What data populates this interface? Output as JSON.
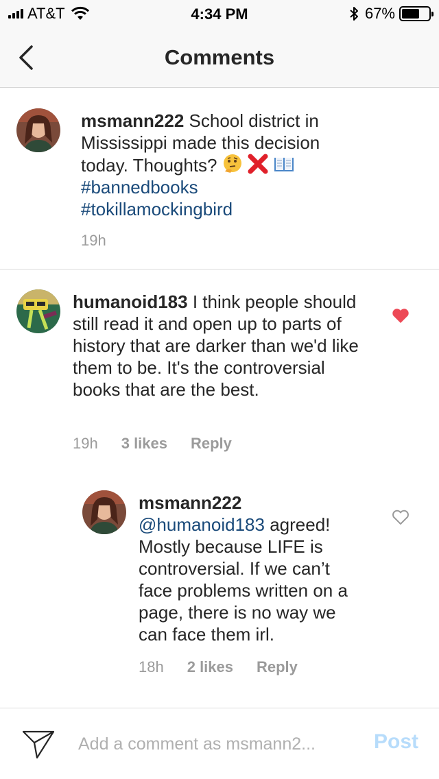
{
  "status_bar": {
    "carrier": "AT&T",
    "time": "4:34 PM",
    "battery_percent": "67%",
    "battery_level": 0.67
  },
  "nav": {
    "back_icon": "chevron-left-icon",
    "title": "Comments"
  },
  "caption": {
    "username": "msmann222",
    "text": "School district in Mississippi made this decision today. Thoughts?",
    "emojis": [
      "thinking-face",
      "cross-mark",
      "open-book"
    ],
    "hashtags": [
      "#bannedbooks",
      "#tokillamockingbird"
    ],
    "time": "19h"
  },
  "comments": [
    {
      "username": "humanoid183",
      "text": "I think people should still read it and open up to parts of history that are darker than we'd like them to be. It's the controversial books that are the best.",
      "time": "19h",
      "likes": "3 likes",
      "reply_label": "Reply",
      "liked": true
    },
    {
      "username": "msmann222",
      "mention": "@humanoid183",
      "text": "agreed! Mostly because LIFE is controversial. If we can’t face problems written on a page, there is no way we can face them irl.",
      "time": "18h",
      "likes": "2 likes",
      "reply_label": "Reply",
      "liked": false
    }
  ],
  "composer": {
    "placeholder": "Add a comment as msmann2...",
    "post_label": "Post"
  },
  "colors": {
    "hashtag": "#1a4a7a",
    "heart_liked": "#ed4956",
    "post_disabled": "#b7dcfb",
    "meta": "#9b9b9b"
  }
}
